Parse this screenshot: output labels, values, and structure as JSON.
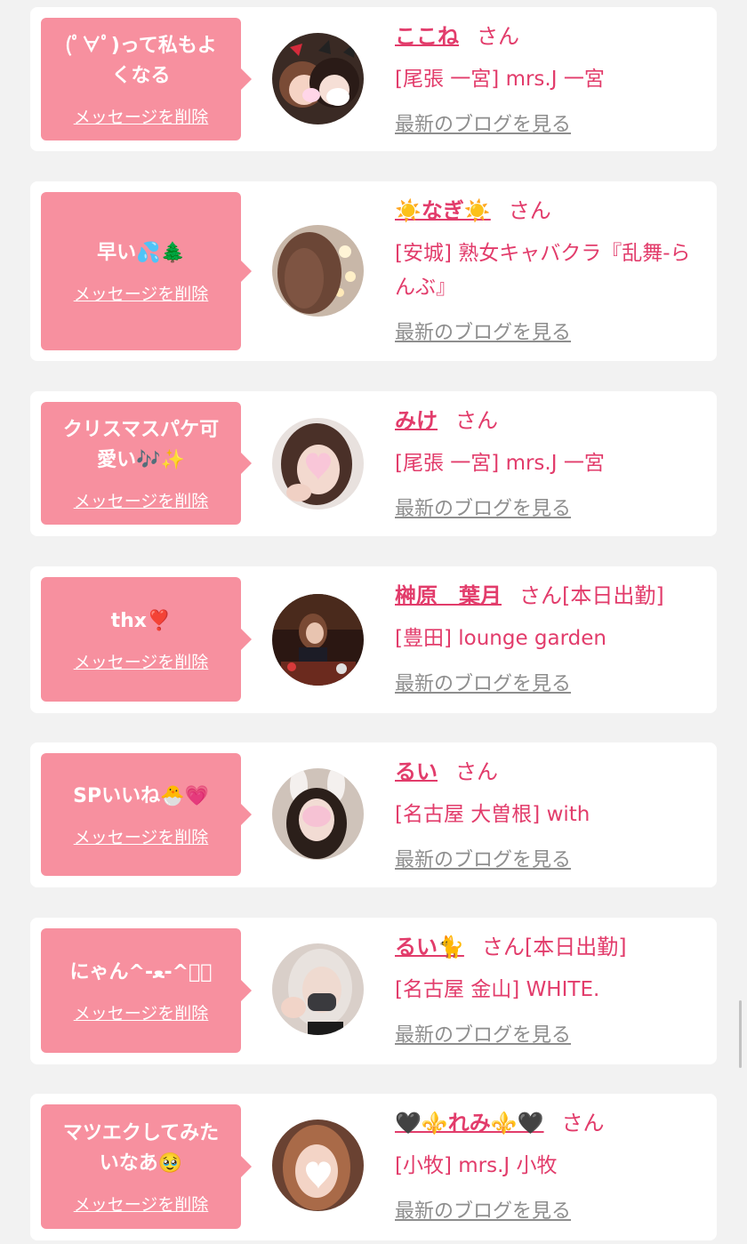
{
  "ui": {
    "delete_label": "メッセージを削除",
    "blog_label": "最新のブログを見る",
    "honorific": "さん"
  },
  "colors": {
    "background": "#f2f2f2",
    "bubble": "#f7909f",
    "accent": "#e23c6b",
    "link_gray": "#8e8e8e"
  },
  "messages": [
    {
      "message": "(ﾟ∀ﾟ)って私もよ\nくなる",
      "name": "ここね",
      "extra": "",
      "shop": "[尾張 一宮] mrs.J 一宮"
    },
    {
      "message": "早い💦🌲",
      "name": "☀️なぎ☀️",
      "extra": "",
      "shop": "[安城] 熟女キャバクラ『乱舞-らんぶ』"
    },
    {
      "message": "クリスマスパケ可\n愛い🎶✨",
      "name": "みけ",
      "extra": "",
      "shop": "[尾張 一宮] mrs.J 一宮"
    },
    {
      "message": "thx❣️",
      "name": "榊原　葉月",
      "extra": "[本日出勤]",
      "shop": "[豊田] lounge garden"
    },
    {
      "message": "SPいいね🐣💗",
      "name": "るい",
      "extra": "",
      "shop": "[名古屋 大曽根] with"
    },
    {
      "message": "にゃん^-﻿ﻌ-^ฅ゙",
      "name": "るい🐈",
      "extra": "[本日出勤]",
      "shop": "[名古屋 金山] WHITE."
    },
    {
      "message": "マツエクしてみた\nいなあ🥹",
      "name": "🖤⚜️れみ⚜️🖤",
      "extra": "",
      "shop": "[小牧] mrs.J 小牧"
    }
  ]
}
